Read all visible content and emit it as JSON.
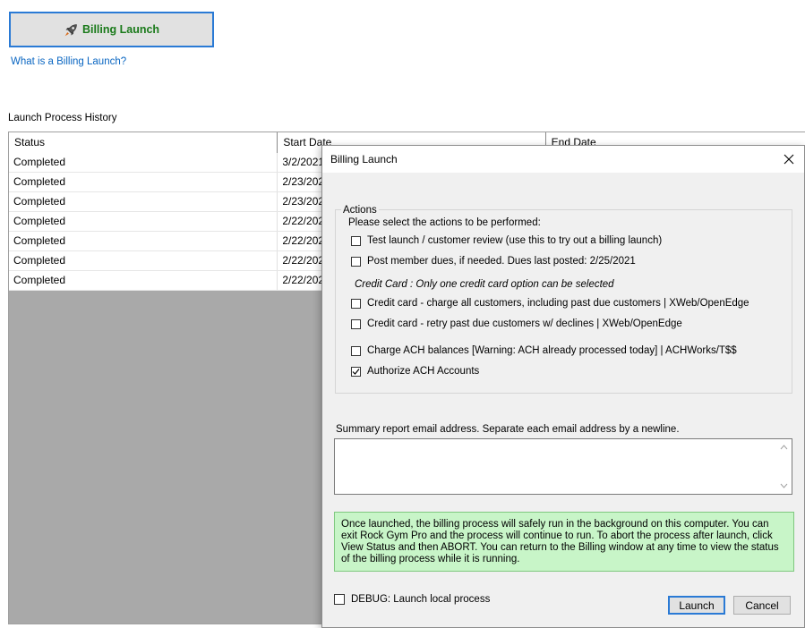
{
  "main": {
    "launch_button_label": "Billing Launch",
    "help_link": "What is a Billing Launch?",
    "history_label": "Launch Process History",
    "grid": {
      "columns": [
        "Status",
        "Start Date",
        "End Date"
      ],
      "rows": [
        [
          "Completed",
          "3/2/2021",
          ""
        ],
        [
          "Completed",
          "2/23/202",
          ""
        ],
        [
          "Completed",
          "2/23/202",
          ""
        ],
        [
          "Completed",
          "2/22/202",
          ""
        ],
        [
          "Completed",
          "2/22/202",
          ""
        ],
        [
          "Completed",
          "2/22/202",
          ""
        ],
        [
          "Completed",
          "2/22/202",
          ""
        ]
      ]
    }
  },
  "dialog": {
    "title": "Billing Launch",
    "actions_legend": "Actions",
    "actions_prompt": "Please select the actions to be performed:",
    "options": {
      "test_launch": {
        "label": "Test launch / customer review (use this to try out a billing launch)",
        "checked": false
      },
      "post_dues": {
        "label": "Post member dues, if needed.  Dues last posted: 2/25/2021",
        "checked": false
      },
      "cc_all": {
        "label": "Credit card - charge all customers, including past due customers | XWeb/OpenEdge",
        "checked": false
      },
      "cc_retry": {
        "label": "Credit card - retry past due customers w/ declines | XWeb/OpenEdge",
        "checked": false
      },
      "ach_charge": {
        "label": "Charge ACH balances [Warning: ACH already processed today] | ACHWorks/T$$",
        "checked": false
      },
      "ach_authorize": {
        "label": "Authorize ACH Accounts",
        "checked": true
      }
    },
    "credit_card_note": "Credit Card : Only one credit card option can be selected",
    "email_label": "Summary report email address.  Separate each email address by a newline.",
    "email_value": "",
    "info_text": "Once launched, the billing process will safely run in the background on this computer.  You can exit Rock Gym Pro and the process will continue to run.  To abort the process after launch, click View Status and then ABORT.  You can return to the Billing window at any time to view the status of the billing process while it is running.",
    "debug": {
      "label": "DEBUG: Launch local process",
      "checked": false
    },
    "launch_button": "Launch",
    "cancel_button": "Cancel"
  },
  "colors": {
    "accent_blue": "#2a7ad5",
    "launch_text_green": "#1a7a1a",
    "info_bg": "#c8f5c8",
    "grid_empty_bg": "#a9a9a9"
  },
  "icons": [
    "rocket-icon",
    "close-icon",
    "checkmark-icon",
    "scroll-up-icon",
    "scroll-down-icon"
  ]
}
